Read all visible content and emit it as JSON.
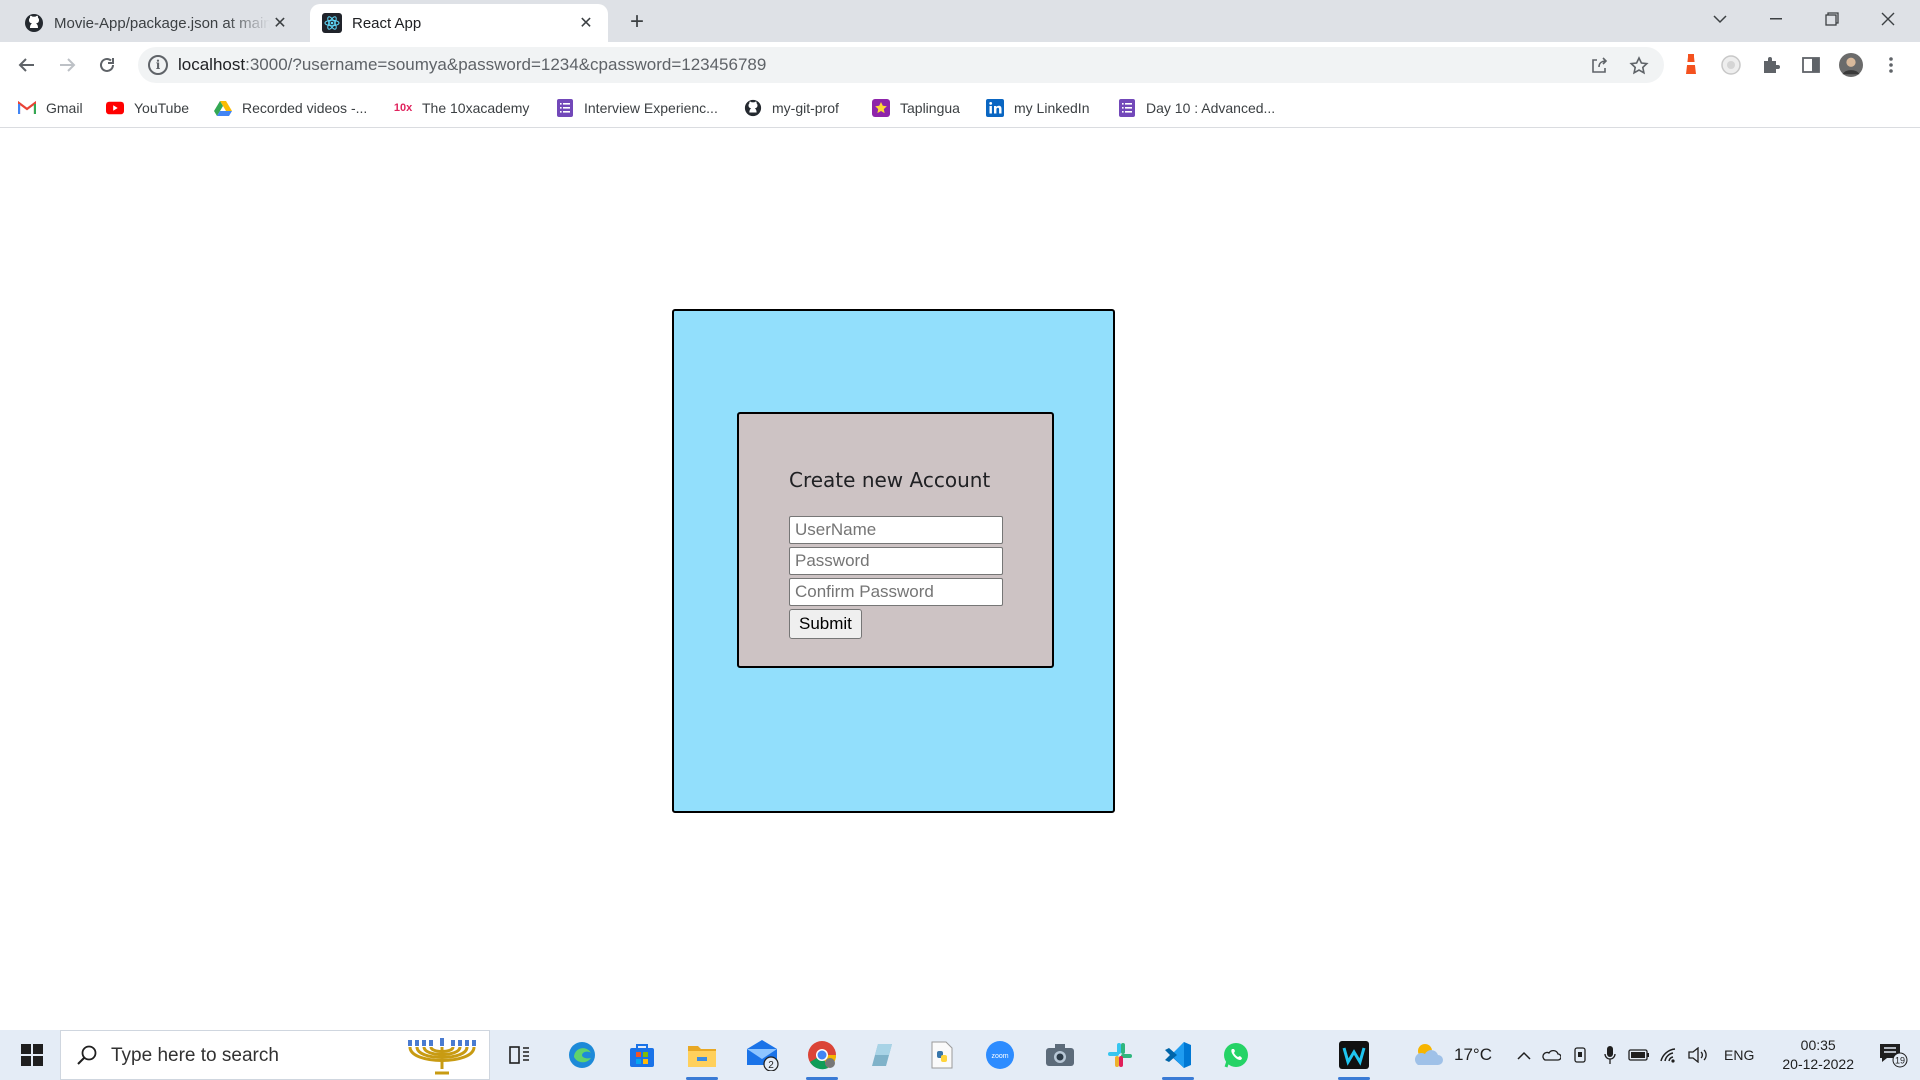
{
  "browser": {
    "tabs": [
      {
        "title": "Movie-App/package.json at main · soumya",
        "icon": "github-icon",
        "active": false
      },
      {
        "title": "React App",
        "icon": "react-icon",
        "active": true
      }
    ],
    "url": {
      "host": "localhost",
      "rest": ":3000/?username=soumya&password=1234&cpassword=123456789"
    },
    "bookmarks": [
      {
        "label": "Gmail",
        "icon": "gmail-icon"
      },
      {
        "label": "YouTube",
        "icon": "youtube-icon"
      },
      {
        "label": "Recorded videos -...",
        "icon": "google-drive-icon"
      },
      {
        "label": "The 10xacademy",
        "icon": "10x-icon"
      },
      {
        "label": "Interview Experienc...",
        "icon": "forms-icon"
      },
      {
        "label": "my-git-prof",
        "icon": "github-icon"
      },
      {
        "label": "Taplingua",
        "icon": "star-icon"
      },
      {
        "label": "my LinkedIn",
        "icon": "linkedin-icon"
      },
      {
        "label": "Day 10 : Advanced...",
        "icon": "forms-icon"
      }
    ]
  },
  "form": {
    "title": "Create new Account",
    "username_placeholder": "UserName",
    "password_placeholder": "Password",
    "confirm_placeholder": "Confirm Password",
    "submit_label": "Submit"
  },
  "colors": {
    "outer_bg": "#92dffc",
    "inner_bg": "#cdc3c4"
  },
  "taskbar": {
    "search_placeholder": "Type here to search",
    "mail_badge": "2",
    "weather": "17°C",
    "language": "ENG",
    "time": "00:35",
    "date": "20-12-2022",
    "notification_count": "19"
  }
}
